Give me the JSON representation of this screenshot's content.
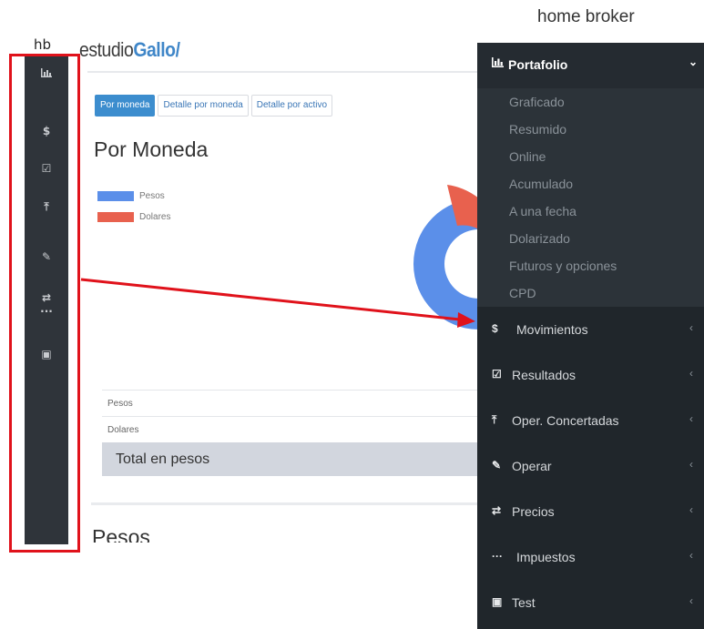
{
  "left_app": {
    "hb_label": "hb",
    "logo": {
      "part1": "estudio",
      "part2": "Gallo",
      "part3": "/"
    },
    "mini_sidebar_icons": [
      "chart-icon",
      "dollar-icon",
      "check-square-icon",
      "upload-icon",
      "edit-icon",
      "exchange-icon",
      "ellipsis-icon",
      "id-card-icon"
    ],
    "tabs": [
      {
        "label": "Por moneda",
        "active": true
      },
      {
        "label": "Detalle por moneda",
        "active": false
      },
      {
        "label": "Detalle por activo",
        "active": false
      }
    ],
    "page_title": "Por Moneda",
    "legend": [
      {
        "label": "Pesos",
        "color": "#5b8fe9"
      },
      {
        "label": "Dolares",
        "color": "#e8614e"
      }
    ],
    "table": {
      "rows": [
        "Pesos",
        "Dolares"
      ],
      "total_label": "Total en pesos"
    },
    "section_title": "Pesos"
  },
  "menu": {
    "title": "home broker",
    "header": {
      "label": "Portafolio",
      "icon": "bar-chart-icon",
      "expanded": true
    },
    "subitems": [
      "Graficado",
      "Resumido",
      "Online",
      "Acumulado",
      "A una fecha",
      "Dolarizado",
      "Futuros y opciones",
      "CPD"
    ],
    "items": [
      {
        "label": "Movimientos",
        "icon": "$"
      },
      {
        "label": "Resultados",
        "icon": "☑"
      },
      {
        "label": "Oper. Concertadas",
        "icon": "⤒"
      },
      {
        "label": "Operar",
        "icon": "✎"
      },
      {
        "label": "Precios",
        "icon": "⇄"
      },
      {
        "label": "Impuestos",
        "icon": "···"
      },
      {
        "label": "Test",
        "icon": "▣"
      }
    ]
  },
  "colors": {
    "highlight": "#e0121b",
    "menu_bg": "#20262b",
    "accent": "#3c8dce"
  }
}
